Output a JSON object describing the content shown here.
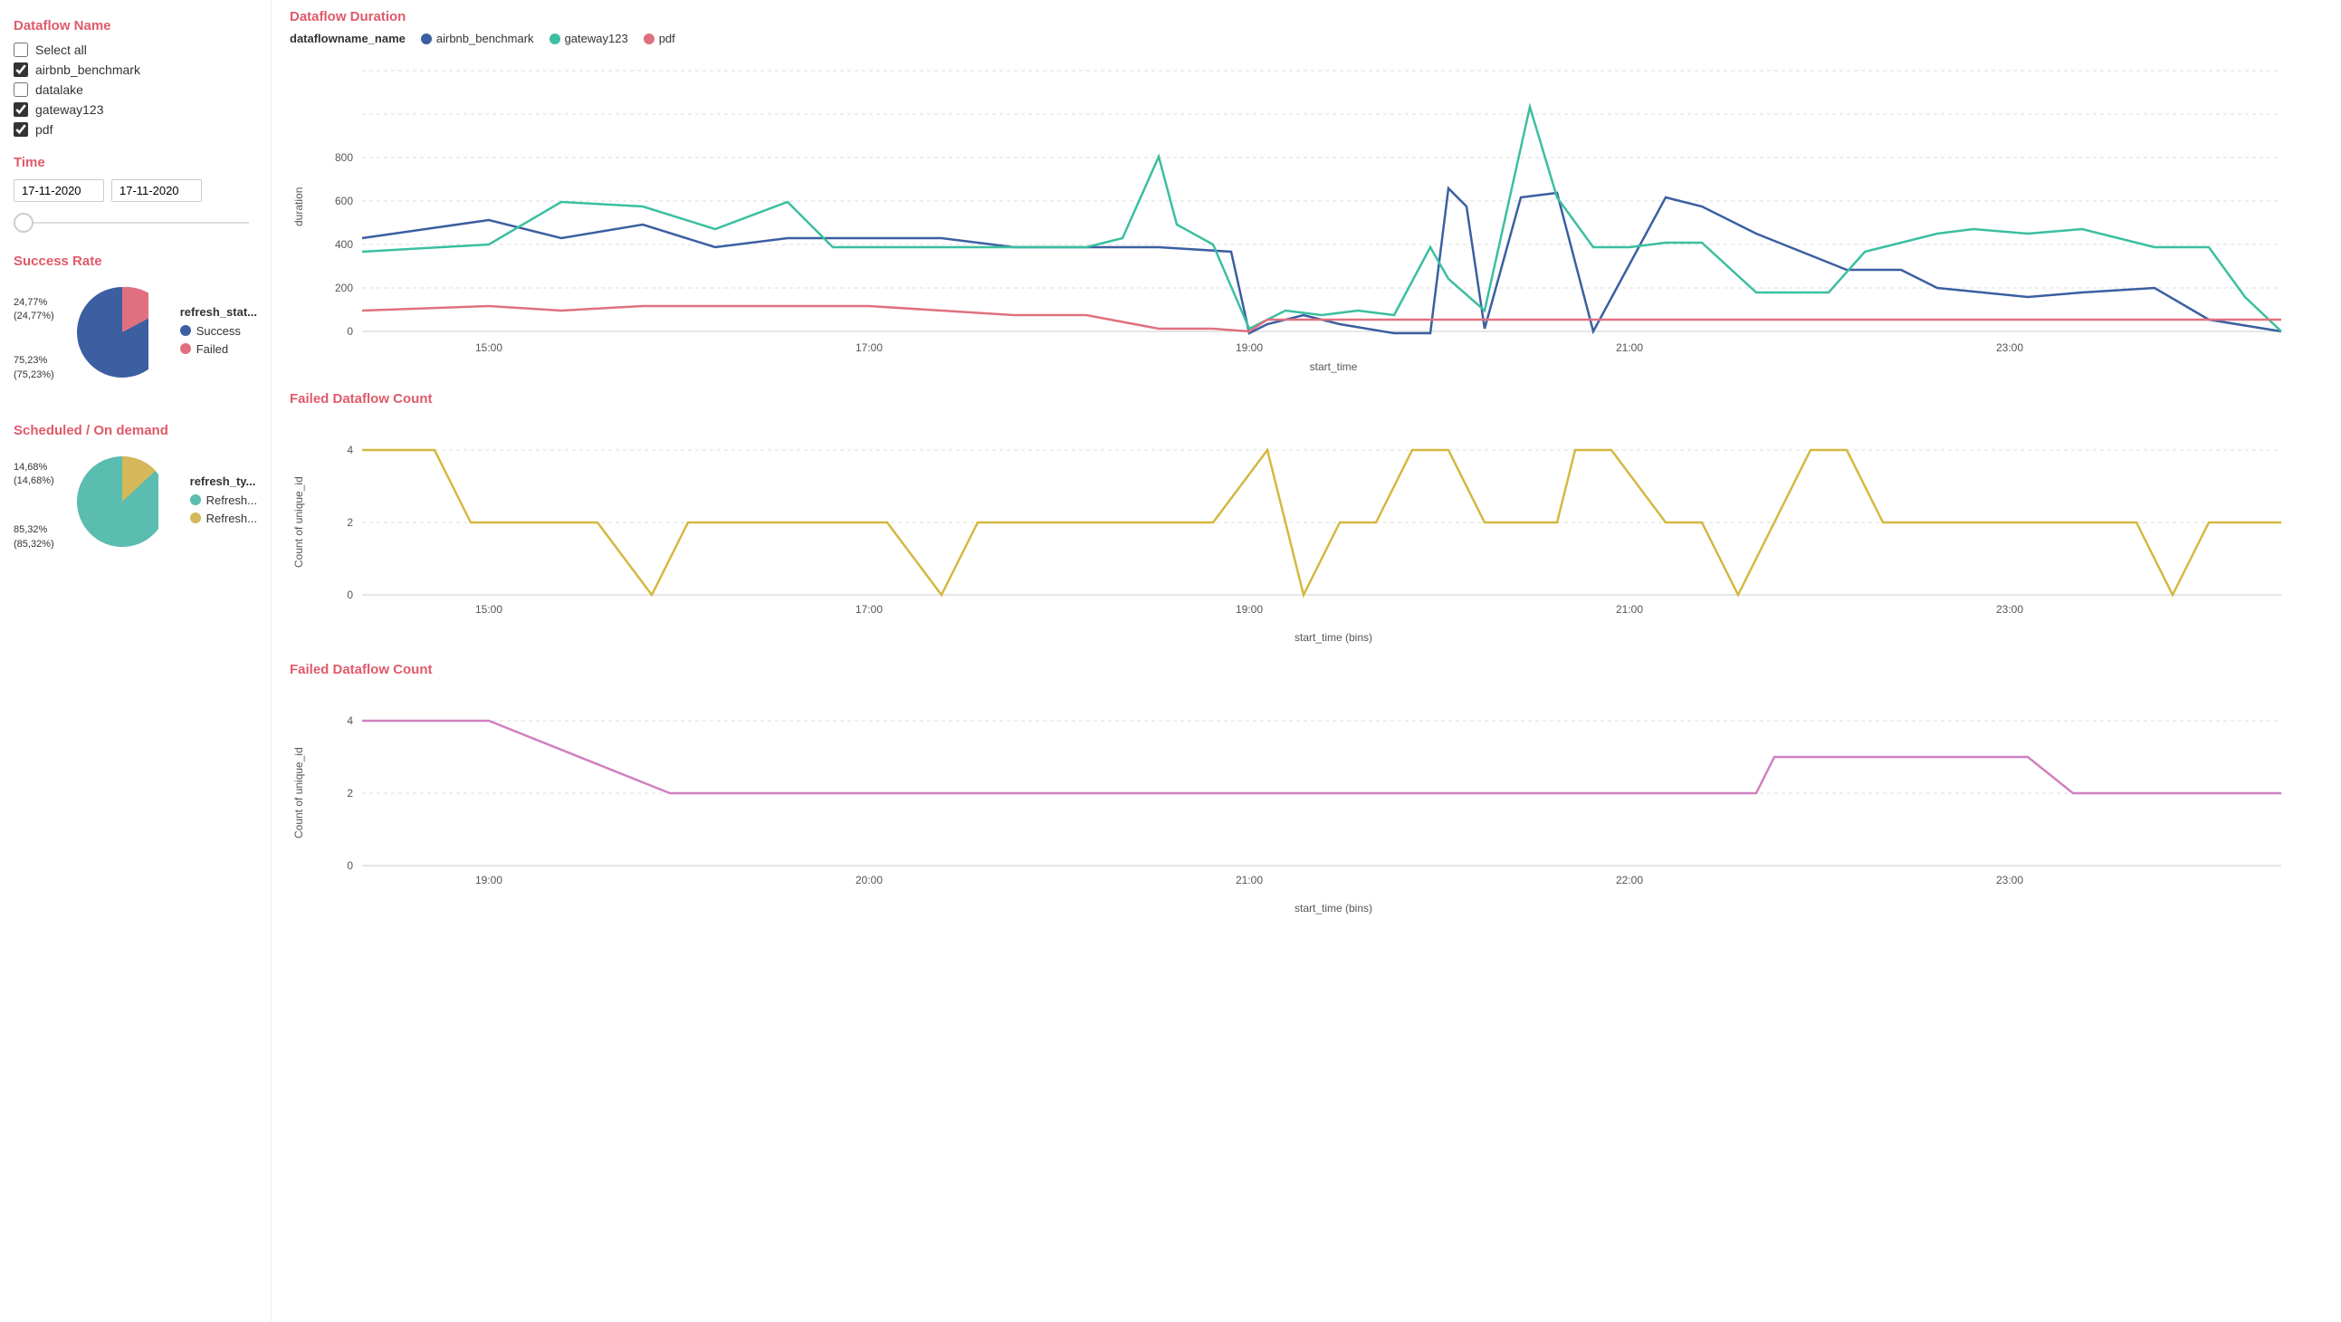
{
  "sidebar": {
    "dataflow_name_title": "Dataflow Name",
    "select_all_label": "Select all",
    "checkboxes": [
      {
        "id": "airbnb",
        "label": "airbnb_benchmark",
        "checked": true
      },
      {
        "id": "datalake",
        "label": "datalake",
        "checked": false
      },
      {
        "id": "gateway",
        "label": "gateway123",
        "checked": true
      },
      {
        "id": "pdf",
        "label": "pdf",
        "checked": true
      }
    ],
    "time_title": "Time",
    "date_from": "17-11-2020",
    "date_to": "17-11-2020"
  },
  "success_rate": {
    "title": "Success Rate",
    "legend_title": "refresh_stat...",
    "success_label": "Success",
    "failed_label": "Failed",
    "success_pct": 75.23,
    "failed_pct": 24.77,
    "success_color": "#3b5fa0",
    "failed_color": "#e07080",
    "label_top": "24,77%",
    "label_top2": "(24,77%)",
    "label_bottom": "75,23%",
    "label_bottom2": "(75,23%)"
  },
  "scheduled": {
    "title": "Scheduled / On demand",
    "legend_title": "refresh_ty...",
    "refresh1_label": "Refresh...",
    "refresh2_label": "Refresh...",
    "pct1": 85.32,
    "pct2": 14.68,
    "color1": "#5bbcb0",
    "color2": "#d4b85a",
    "label_top": "14,68%",
    "label_top2": "(14,68%)",
    "label_bottom": "85,32%",
    "label_bottom2": "(85,32%)"
  },
  "dataflow_duration": {
    "title": "Dataflow Duration",
    "legend_label": "dataflowname_name",
    "series": [
      "airbnb_benchmark",
      "gateway123",
      "pdf"
    ],
    "colors": [
      "#3b5fa0",
      "#3bbfa0",
      "#e07080"
    ],
    "y_label": "duration",
    "x_label": "start_time",
    "x_ticks": [
      "15:00",
      "17:00",
      "19:00",
      "21:00",
      "23:00"
    ],
    "y_ticks": [
      0,
      200,
      400,
      600,
      800
    ]
  },
  "failed_count1": {
    "title": "Failed Dataflow Count",
    "y_label": "Count of unique_id",
    "x_label": "start_time (bins)",
    "x_ticks": [
      "15:00",
      "17:00",
      "19:00",
      "21:00",
      "23:00"
    ],
    "y_ticks": [
      0,
      2,
      4
    ],
    "color": "#d4b840"
  },
  "failed_count2": {
    "title": "Failed Dataflow Count",
    "y_label": "Count of unique_id",
    "x_label": "start_time (bins)",
    "x_ticks": [
      "19:00",
      "20:00",
      "21:00",
      "22:00",
      "23:00"
    ],
    "y_ticks": [
      0,
      2,
      4
    ],
    "color": "#d080c0"
  }
}
